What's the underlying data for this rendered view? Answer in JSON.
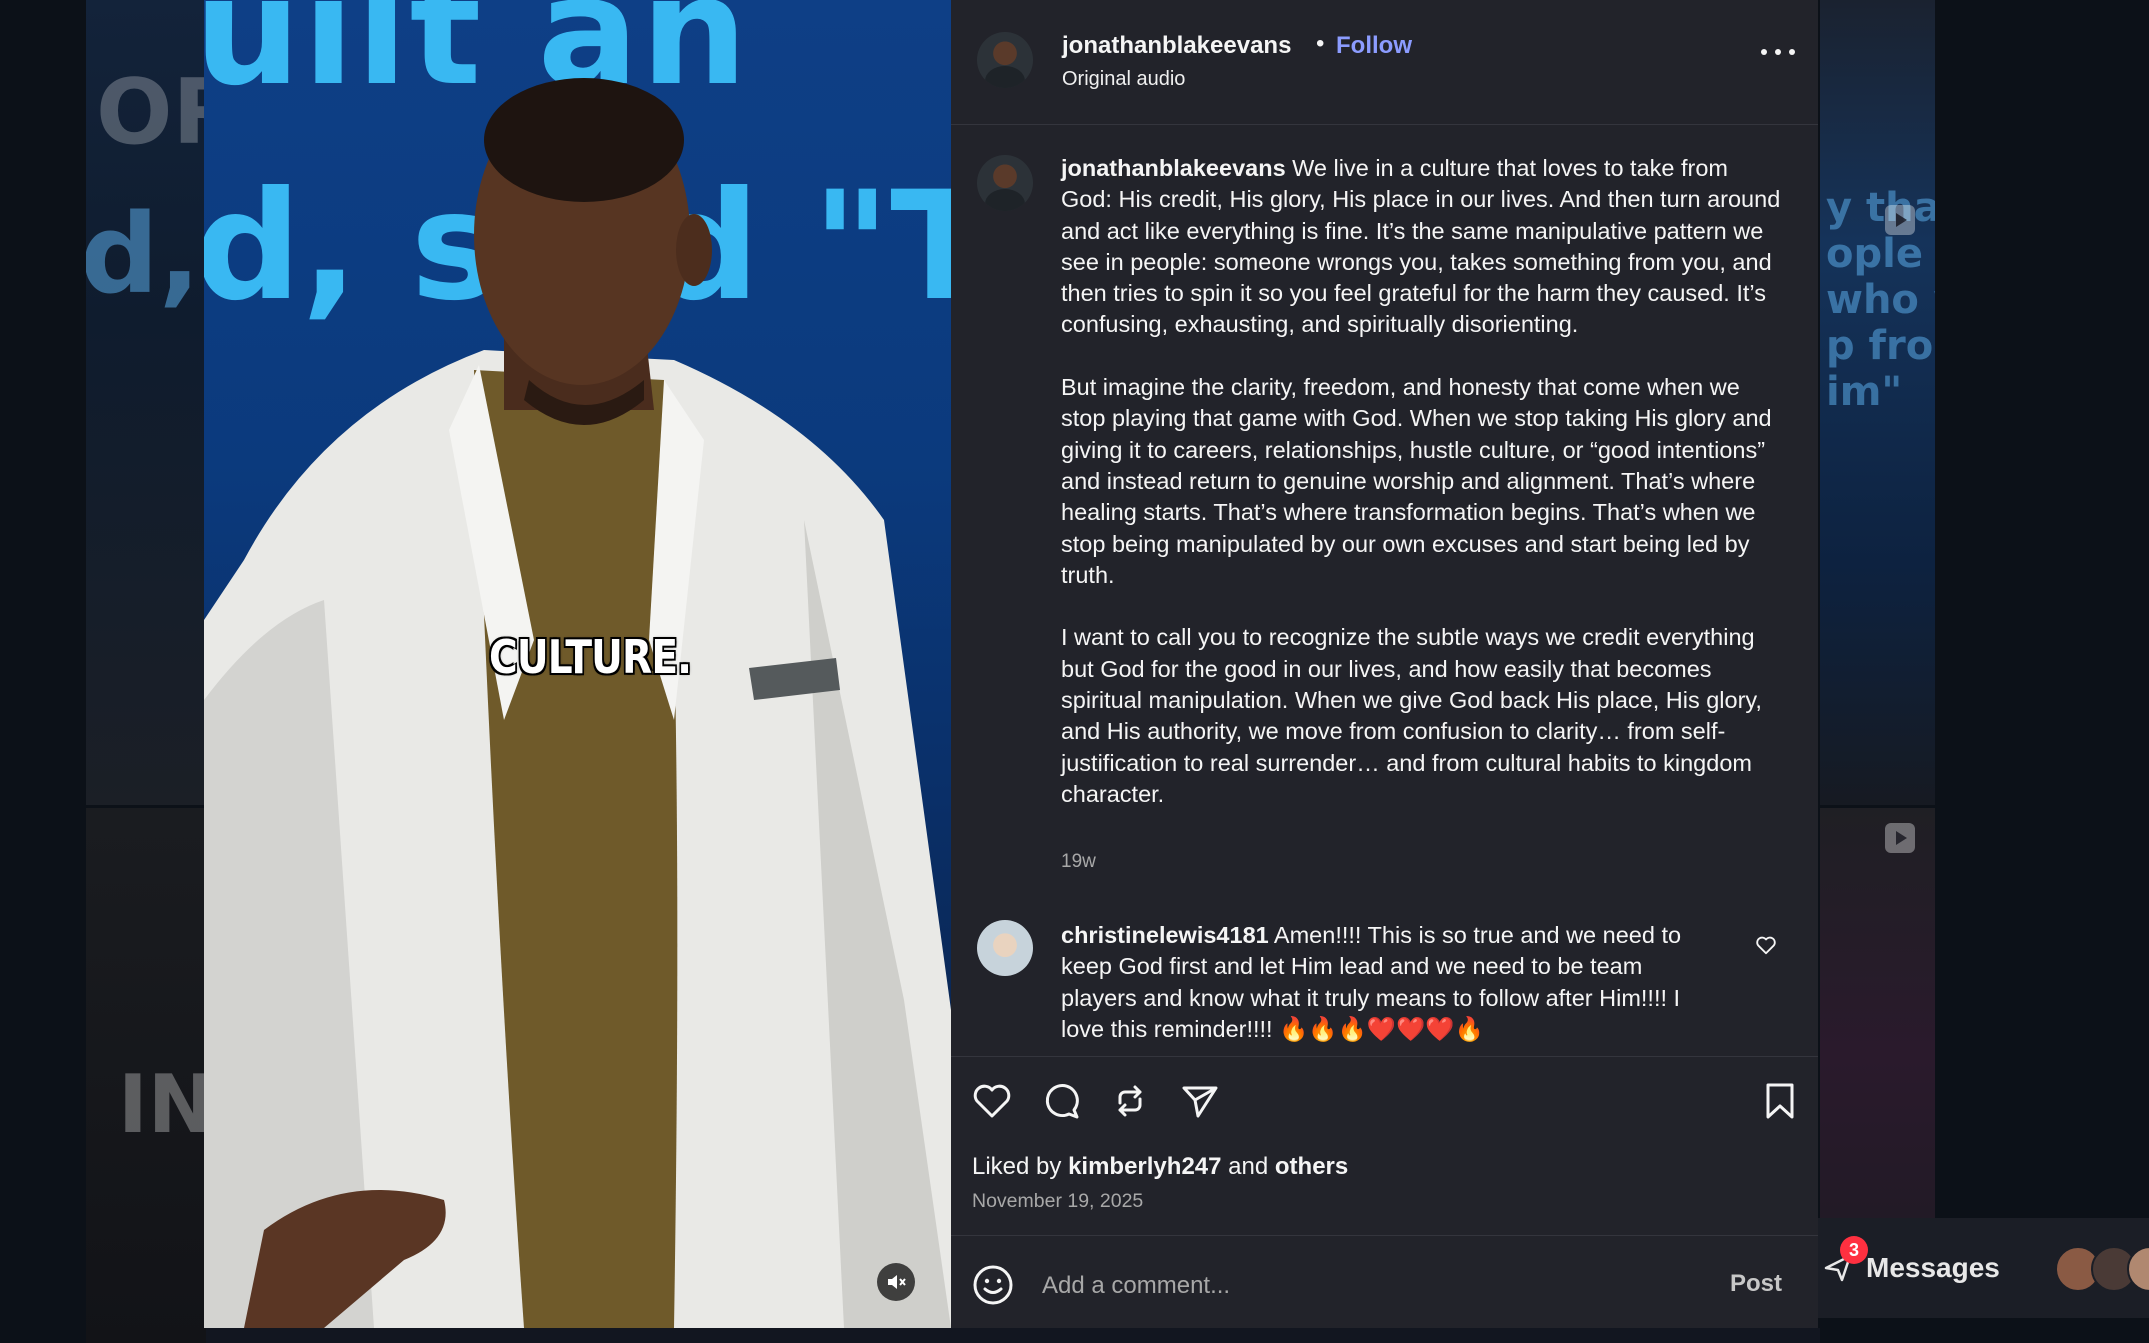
{
  "post": {
    "username": "jonathanblakeevans",
    "follow_label": "Follow",
    "separator": "•",
    "audio_label": "Original audio"
  },
  "media": {
    "bg_text_top": "uilt an",
    "bg_text_mid": "d, said \"To",
    "caption": "CULTURE."
  },
  "caption_comment": {
    "username": "jonathanblakeevans",
    "text": " We live in a culture that loves to take from God: His credit, His glory, His place in our lives. And then turn around and act like everything is fine. It’s the same manipulative pattern we see in people: someone wrongs you, takes something from you, and then tries to spin it so you feel grateful for the harm they caused. It’s confusing, exhausting, and spiritually disorienting.\n\nBut imagine the clarity, freedom, and honesty that come when we stop playing that game with God. When we stop taking His glory and giving it to careers, relationships, hustle culture, or “good intentions” and instead return to genuine worship and alignment. That’s where healing starts. That’s where transformation begins. That’s when we stop being manipulated by our own excuses and start being led by truth.\n\nI want to call you to recognize the subtle ways we credit everything but God for the good in our lives, and how easily that becomes spiritual manipulation. When we give God back His place, His glory, and His authority, we move from confusion to clarity… from self-justification to real surrender… and from cultural habits to kingdom character.",
    "time": "19w"
  },
  "comments": [
    {
      "username": "christinelewis4181",
      "text": " Amen!!!! This is so true and we need to keep God first and let Him lead and we need to be team players and know what it truly means to follow after Him!!!! I love this reminder!!!! 🔥🔥🔥❤️❤️❤️🔥"
    }
  ],
  "engagement": {
    "liked_prefix": "Liked by ",
    "liked_user": "kimberlyh247",
    "liked_middle": " and ",
    "liked_others": "others",
    "date": "November 19, 2025"
  },
  "composer": {
    "placeholder": "Add a comment...",
    "post_label": "Post"
  },
  "messages": {
    "label": "Messages",
    "badge": "3"
  },
  "background": {
    "right_text": "y that\nople ass\nwho wi\np fron\nim\"",
    "left_text": "IN"
  },
  "colors": {
    "panel": "#22232a",
    "follow": "#8c9cff",
    "badge": "#ff3040"
  }
}
